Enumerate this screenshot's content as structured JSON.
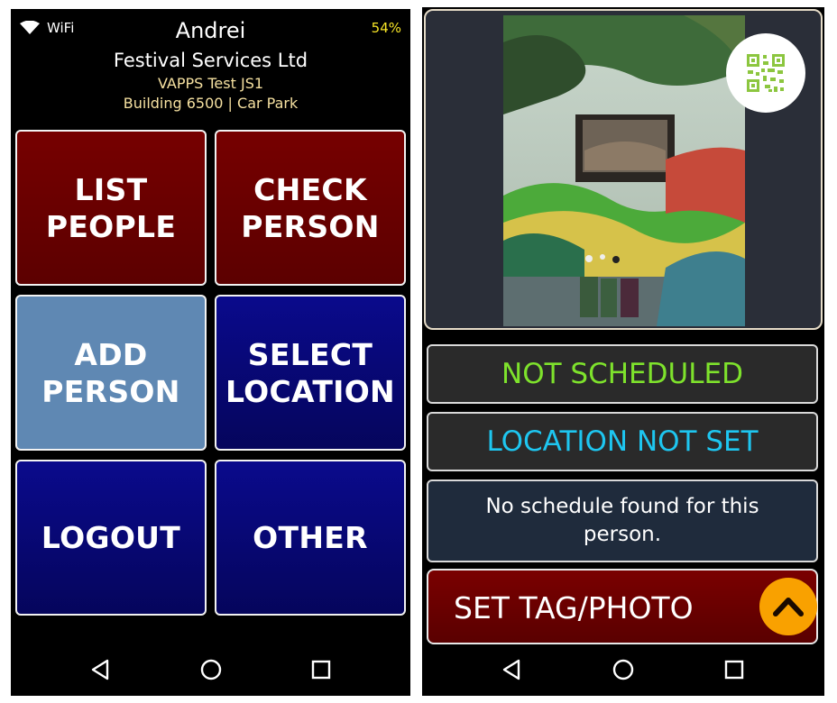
{
  "left": {
    "status": {
      "network": "WiFi",
      "battery": "54%"
    },
    "header": {
      "user": "Andrei",
      "company": "Festival Services Ltd",
      "site": "VAPPS Test JS1",
      "location": "Building 6500 | Car Park"
    },
    "tiles": [
      {
        "label": "LIST\nPEOPLE",
        "color": "#6a0000"
      },
      {
        "label": "CHECK\nPERSON",
        "color": "#6a0000"
      },
      {
        "label": "ADD\nPERSON",
        "color": "#5f88b3"
      },
      {
        "label": "SELECT\nLOCATION",
        "color": "#080875"
      },
      {
        "label": "LOGOUT",
        "color": "#080875"
      },
      {
        "label": "OTHER",
        "color": "#080875"
      }
    ]
  },
  "right": {
    "camera": {
      "qr_icon": "qr-code-icon"
    },
    "schedule_status": "NOT SCHEDULED",
    "location_status": "LOCATION NOT SET",
    "message": "No schedule found for this person.",
    "action": {
      "label": "SET TAG/PHOTO",
      "icon": "chevron-up-icon"
    }
  },
  "navbar": {
    "icons": [
      "back-icon",
      "home-icon",
      "recents-icon"
    ]
  },
  "colors": {
    "accent_yellow": "#f5e326",
    "scheduled_green": "#7ee22c",
    "location_cyan": "#1ec6f0",
    "fab_orange": "#f9a100"
  }
}
